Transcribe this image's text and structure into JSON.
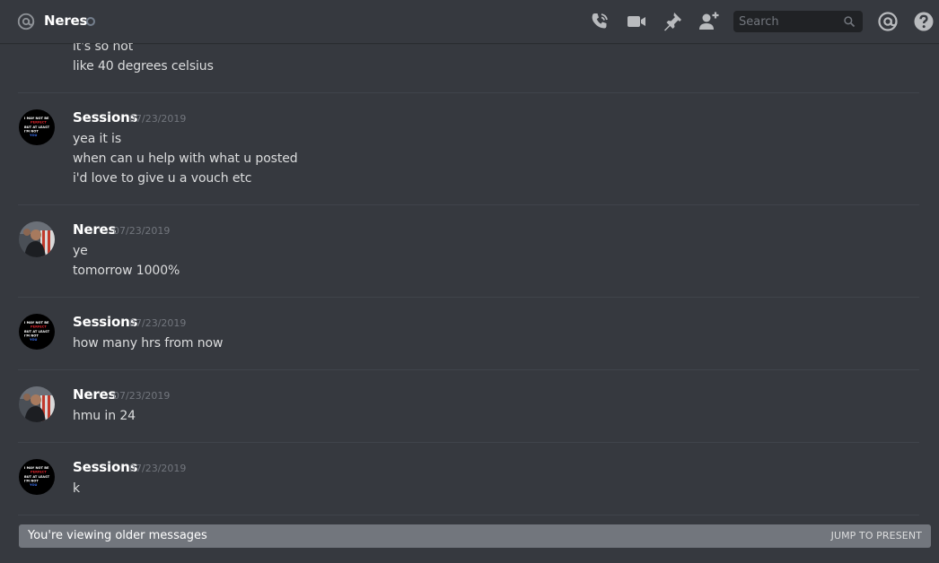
{
  "header": {
    "channel_name": "Neres",
    "search_placeholder": "Search",
    "icons": [
      "at-icon",
      "status-icon",
      "call-icon",
      "video-icon",
      "pin-icon",
      "add-friend-icon",
      "search-icon",
      "mention-icon",
      "help-icon"
    ]
  },
  "messages": [
    {
      "author": "",
      "timestamp": "",
      "lines": [
        "it's so hot",
        "like 40 degrees celsius"
      ]
    },
    {
      "author": "Sessions",
      "timestamp": "07/23/2019",
      "lines": [
        "yea it is",
        "when can u help with what u posted",
        "i'd love to give u a vouch etc"
      ]
    },
    {
      "author": "Neres",
      "timestamp": "07/23/2019",
      "lines": [
        "ye",
        "tomorrow 1000%"
      ]
    },
    {
      "author": "Sessions",
      "timestamp": "07/23/2019",
      "lines": [
        "how many hrs from now"
      ]
    },
    {
      "author": "Neres",
      "timestamp": "07/23/2019",
      "lines": [
        "hmu in 24"
      ]
    },
    {
      "author": "Sessions",
      "timestamp": "07/23/2019",
      "lines": [
        "k"
      ]
    }
  ],
  "avatar_text": [
    "I MAY NOT BE",
    "PERFECT",
    "BUT AT LEAST",
    "I'M NOT",
    "YOU"
  ],
  "older_bar": {
    "text": "You're viewing older messages",
    "jump_label": "JUMP TO PRESENT"
  },
  "colors": {
    "background": "#36393f",
    "header_text": "#ffffff",
    "message_text": "#dcddde",
    "timestamp": "#72767d",
    "divider": "#40444b",
    "older_bar": "#72767d",
    "search_bg": "#202225"
  }
}
